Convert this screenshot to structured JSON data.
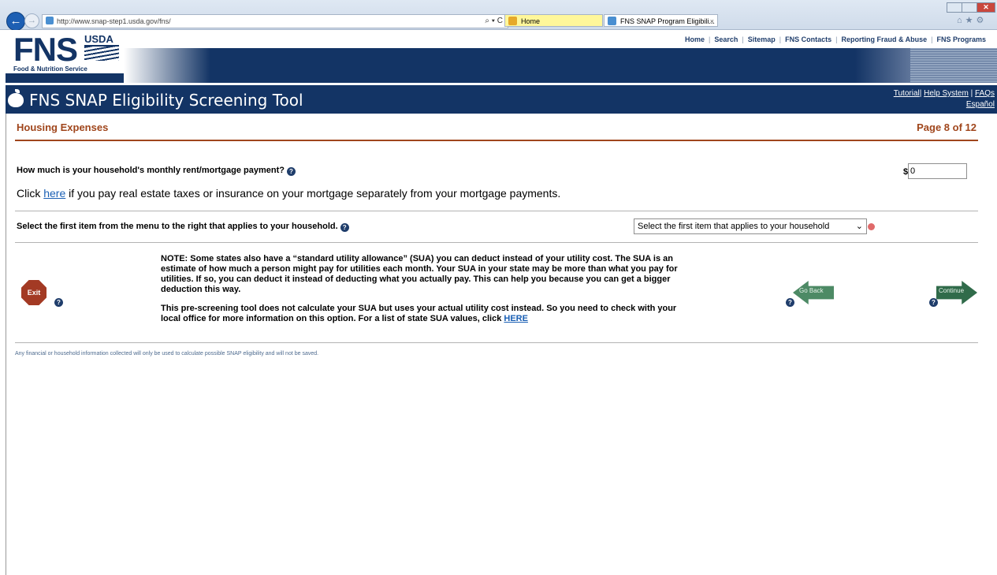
{
  "browser": {
    "url": "http://www.snap-step1.usda.gov/fns/",
    "address_controls": "⌕ ▾ C",
    "tabs": [
      {
        "label": "Home"
      },
      {
        "label": "FNS SNAP Program Eligibili..."
      }
    ],
    "tab_close": "×",
    "toolbar_icons": "⌂★⚙",
    "close_glyph": "✕"
  },
  "header": {
    "logo_text": "FNS",
    "usda_text": "USDA",
    "logo_caption": "Food & Nutrition Service",
    "top_links": [
      "Home",
      "Search",
      "Sitemap",
      "FNS Contacts",
      "Reporting Fraud & Abuse",
      "FNS Programs"
    ],
    "top_link_separator": "|"
  },
  "app": {
    "title": "FNS SNAP Eligibility Screening Tool",
    "util_links": {
      "tutorial": "Tutorial",
      "help_system": "Help System",
      "faqs": "FAQs",
      "sep": "|",
      "spanish": "Español"
    }
  },
  "section": {
    "title": "Housing Expenses",
    "page_indicator": "Page 8 of 12"
  },
  "rent": {
    "question": "How much is your household's monthly rent/mortgage payment?",
    "currency": "$",
    "value": "0"
  },
  "tax_link_line": {
    "prefix": "Click ",
    "link": "here",
    "suffix": " if you pay real estate taxes or insurance on your mortgage separately from your mortgage payments."
  },
  "utility": {
    "question": "Select the first item from the menu to the right that applies to your household.",
    "selected": "Select the first item that applies to your household",
    "chevron": "⌄"
  },
  "help_glyph": "?",
  "note": {
    "paragraph1": "NOTE: Some states also have a “standard utility allowance” (SUA) you can deduct instead of your utility cost. The SUA is an estimate of how much a person might pay for utilities each month. Your SUA in your state may be more than what you pay for utilities. If so, you can deduct it instead of deducting what you actually pay. This can help you because you can get a bigger deduction this way.",
    "paragraph2_prefix": "This pre-screening tool does not calculate your SUA but uses your actual utility cost instead. So you need to check with your local office for more information on this option. For a list of state SUA values, click ",
    "paragraph2_link": "HERE"
  },
  "nav": {
    "exit_label": "Exit",
    "go_back_label": "Go Back",
    "continue_label": "Continue"
  },
  "footer": {
    "text": "Any financial or household information collected will only be used to calculate possible SNAP eligibility and will not be saved."
  },
  "colors": {
    "brand_navy": "#133465",
    "section_accent": "#a0461c",
    "link_blue": "#1a5fb4"
  }
}
